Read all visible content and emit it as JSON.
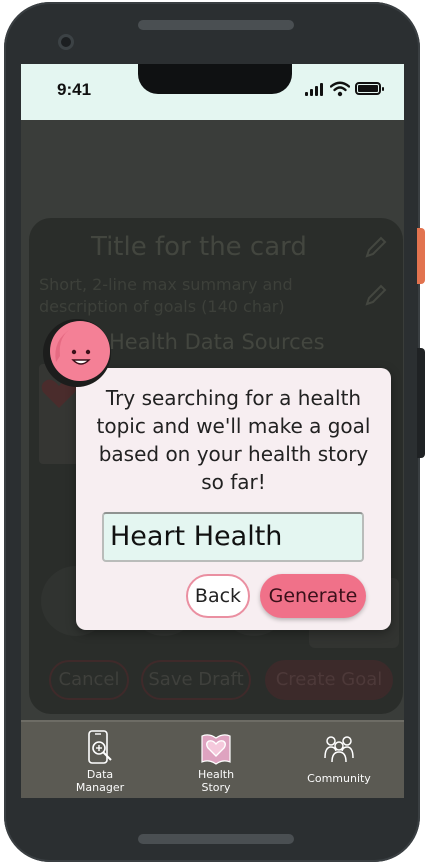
{
  "status_bar": {
    "time": "9:41"
  },
  "card": {
    "title": "Title for the card",
    "summary": "Short, 2-line max summary and description of goals (140 char)",
    "sources_heading": "Health Data Sources"
  },
  "actions": {
    "cancel": "Cancel",
    "save_draft": "Save Draft",
    "create_goal": "Create Goal"
  },
  "dialog": {
    "message": "Try searching for a health topic and we'll make a goal based on your health story so far!",
    "input_value": "Heart Health",
    "back": "Back",
    "generate": "Generate"
  },
  "nav": {
    "items": [
      {
        "label_line1": "Data",
        "label_line2": "Manager",
        "icon": "phone-search-icon"
      },
      {
        "label_line1": "Health",
        "label_line2": "Story",
        "icon": "heart-book-icon",
        "active": true
      },
      {
        "label_line1": "Community",
        "label_line2": "",
        "icon": "people-icon"
      }
    ]
  },
  "colors": {
    "accent": "#f07189",
    "status_bar_bg": "#e4f6f1",
    "nav_bg": "#5b5a53",
    "dialog_bg": "#f7eef1"
  }
}
